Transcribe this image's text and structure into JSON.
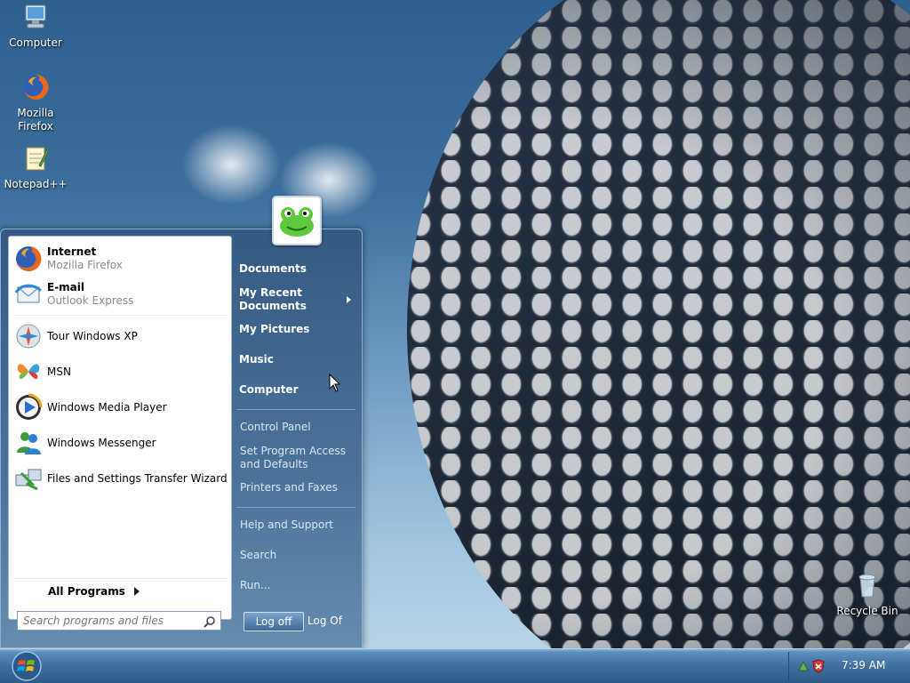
{
  "desktop": {
    "icons": [
      {
        "label": "Computer",
        "icon": "computer-icon"
      },
      {
        "label": "Mozilla Firefox",
        "icon": "firefox-icon"
      },
      {
        "label": "Notepad++",
        "icon": "notepad-icon"
      },
      {
        "label": "Recycle Bin",
        "icon": "recycle-bin-icon"
      }
    ]
  },
  "start_menu": {
    "user_picture": "frog-avatar-icon",
    "pinned": [
      {
        "name": "Internet",
        "sub": "Mozilla Firefox",
        "icon": "firefox-icon"
      },
      {
        "name": "E-mail",
        "sub": "Outlook Express",
        "icon": "outlook-express-icon"
      }
    ],
    "recent": [
      {
        "name": "Tour Windows XP",
        "icon": "tour-icon"
      },
      {
        "name": "MSN",
        "icon": "msn-butterfly-icon"
      },
      {
        "name": "Windows Media Player",
        "icon": "media-player-icon"
      },
      {
        "name": "Windows Messenger",
        "icon": "messenger-icon"
      },
      {
        "name": "Files and Settings Transfer Wizard",
        "icon": "transfer-wizard-icon"
      }
    ],
    "all_programs": "All Programs",
    "search_placeholder": "Search programs and files",
    "right": {
      "documents": "Documents",
      "my_recent_documents_1": "My Recent",
      "my_recent_documents_2": "Documents",
      "my_pictures": "My Pictures",
      "music": "Music",
      "computer": "Computer",
      "control_panel": "Control Panel",
      "set_program_access_1": "Set Program Access",
      "set_program_access_2": "and Defaults",
      "printers": "Printers and Faxes",
      "help": "Help and Support",
      "search": "Search",
      "run": "Run..."
    },
    "logoff_button": "Log off",
    "logoff_label": "Log Of"
  },
  "taskbar": {
    "clock": "7:39 AM",
    "tray_icons": [
      "network-icon",
      "security-shield-icon"
    ]
  }
}
